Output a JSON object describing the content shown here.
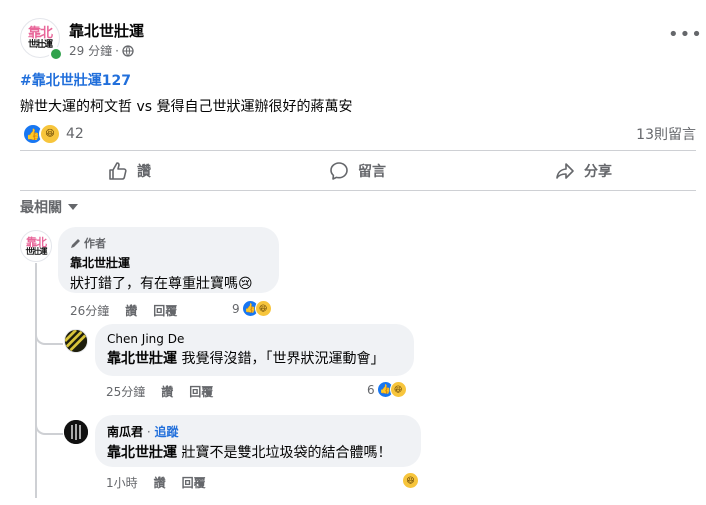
{
  "post": {
    "page_name": "靠北世壯運",
    "logo_top": "靠北",
    "logo_bottom": "世壯運",
    "time": "29 分鐘",
    "sep": "·",
    "hashtag": "#靠北世壯運127",
    "text": "辦世大運的柯文哲 vs 覺得自己世狀運辦很好的蔣萬安",
    "reaction_count": "42",
    "comment_count": "13則留言"
  },
  "actions": {
    "like": "讚",
    "comment": "留言",
    "share": "分享"
  },
  "sort_label": "最相關",
  "comments": [
    {
      "author_tag": "作者",
      "name": "靠北世壯運",
      "text": "狀打錯了，有在尊重壯寶嗎😢",
      "time": "26分鐘",
      "like": "讚",
      "reply": "回覆",
      "reactions": "9"
    },
    {
      "name": "Chen Jing De",
      "mention": "靠北世壯運",
      "text": " 我覺得沒錯，「世界狀況運動會」",
      "time": "25分鐘",
      "like": "讚",
      "reply": "回覆",
      "reactions": "6"
    },
    {
      "name": "南瓜君",
      "follow_sep": " · ",
      "follow": "追蹤",
      "mention": "靠北世壯運",
      "text": " 壯寶不是雙北垃圾袋的結合體嗎！",
      "time": "1小時",
      "like": "讚",
      "reply": "回覆"
    }
  ],
  "colors": {
    "accent": "#1877f2",
    "link": "#216fdb",
    "muted": "#65676b",
    "bubble": "#f0f2f5",
    "logo_pink": "#e8679a"
  }
}
